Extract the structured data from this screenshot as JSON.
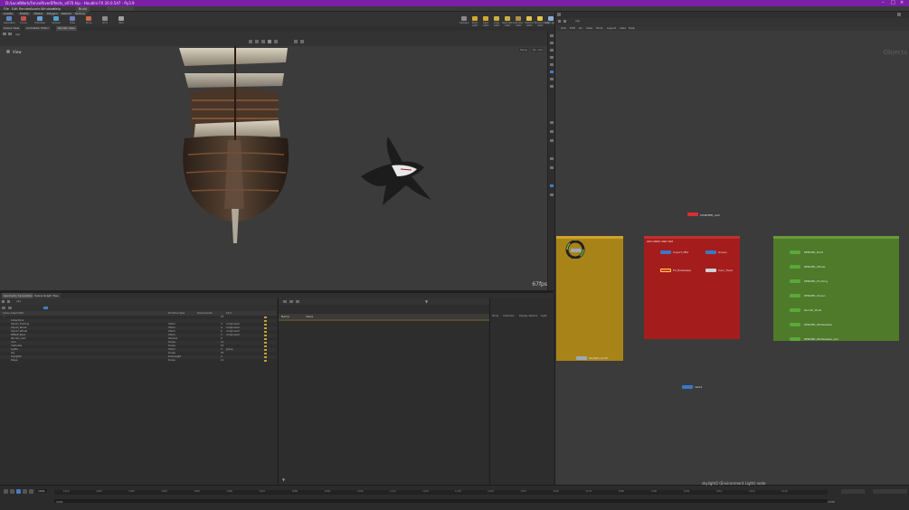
{
  "window": {
    "title": "D:/LocalWork/FenceRiverEffects_v070.hip - Houdini FX 20.0.547 - Py3.9"
  },
  "menu": [
    "File",
    "Edit",
    "Render",
    "Assets",
    "Windows",
    "Help"
  ],
  "workspace": "Build",
  "shelf": {
    "tabs": [
      "Create",
      "Modify",
      "Model",
      "Polygon",
      "Deform",
      "Texture"
    ],
    "tools": [
      "Geometry",
      "Curve",
      "Primitive",
      "Sphere",
      "Tube",
      "Torus",
      "Grid",
      "Null",
      "Circle",
      "Platonic",
      "Box",
      "Line",
      "Spray Paint",
      "Font",
      "L-System",
      "Metaball"
    ]
  },
  "shelf_right": {
    "tools": [
      "Camera",
      "Point Light",
      "Spot Light",
      "Area Light",
      "Geometry Light",
      "Volume Light",
      "Distant Light",
      "Environment Light",
      "Sky Light",
      "GI Light"
    ]
  },
  "pane_tabs": [
    "Scene View",
    "Animation Editor",
    "Render View",
    "Composite View",
    "Motion FX View",
    "Geometry Spreadsheet"
  ],
  "viewport": {
    "label": "View",
    "fps": "67fps",
    "persp_button": "Persp",
    "camera_button": "No cam"
  },
  "bottom_tabs": [
    "Geometry Spreadsheet",
    "Scene Graph Tree"
  ],
  "scene_tree": {
    "columns": [
      "Scene Graph Path",
      "Primitive Type",
      "Descendants",
      "Kind"
    ],
    "rows": [
      {
        "name": "/",
        "type": "",
        "desc": "25",
        "kind": ""
      },
      {
        "name": "Collections",
        "type": "",
        "desc": "",
        "kind": ""
      },
      {
        "name": "Import_Hunting",
        "type": "Xform",
        "desc": "4",
        "kind": "component"
      },
      {
        "name": "Import_Shark",
        "type": "Xform",
        "desc": "4",
        "kind": "component"
      },
      {
        "name": "Import_Whale",
        "type": "Xform",
        "desc": "6",
        "kind": "component"
      },
      {
        "name": "FENCE_Boat",
        "type": "Xform",
        "desc": "3",
        "kind": "component"
      },
      {
        "name": "Render_Cam",
        "type": "Camera",
        "desc": "0",
        "kind": ""
      },
      {
        "name": "cam",
        "type": "Scope",
        "desc": "11",
        "kind": ""
      },
      {
        "name": "materials",
        "type": "Scope",
        "desc": "10",
        "kind": ""
      },
      {
        "name": "Lights",
        "type": "Xform",
        "desc": "3",
        "kind": "group"
      },
      {
        "name": "sky",
        "type": "Scope",
        "desc": "25",
        "kind": ""
      },
      {
        "name": "skylight2",
        "type": "DomeLight",
        "desc": "0",
        "kind": ""
      },
      {
        "name": "Stage",
        "type": "Scope",
        "desc": "11",
        "kind": ""
      }
    ]
  },
  "properties": {
    "columns": [
      "Name",
      "Value"
    ]
  },
  "attr_tabs": [
    "Show",
    "Collection",
    "Display Options",
    "Light"
  ],
  "timeline": {
    "frame": "1001",
    "start": "1001",
    "end": "1240",
    "ticks": [
      "1010",
      "1020",
      "1030",
      "1040",
      "1050",
      "1060",
      "1070",
      "1080",
      "1090",
      "1100",
      "1110",
      "1120",
      "1130",
      "1140",
      "1150",
      "1160",
      "1170",
      "1180",
      "1190",
      "1200",
      "1210",
      "1220",
      "1230"
    ]
  },
  "network": {
    "path": "obj",
    "menu": [
      "Add",
      "Edit",
      "Go",
      "View",
      "Tools",
      "Layout",
      "Labs",
      "Help"
    ],
    "context_label": "Objects",
    "status": "skylight2 (Environment Light) node",
    "boxes": [
      {
        "title": "",
        "color": "#b8901a",
        "nodes": [
          {
            "label": "",
            "color": "#9aa8b8"
          },
          {
            "label": "skylight_rect2",
            "color": "#9aa8b8"
          }
        ]
      },
      {
        "title": "GEO PREP AND SIM",
        "color": "#a51c1c",
        "nodes": [
          {
            "label": "Import_FBX",
            "color": "#3a78c8"
          },
          {
            "label": "Ocean",
            "color": "#3a78c8"
          },
          {
            "label": "FX_Boatwake",
            "color": "#d83030"
          },
          {
            "label": "Cam_Track",
            "color": "#d0d0d0"
          }
        ]
      },
      {
        "title": "",
        "color": "#4e7a2a",
        "nodes": [
          {
            "label": "RENDER_Boat",
            "color": "#5aa83a"
          },
          {
            "label": "RENDER_Whale",
            "color": "#5aa83a"
          },
          {
            "label": "RENDER_Hunting",
            "color": "#5aa83a"
          },
          {
            "label": "RENDER_Ocean",
            "color": "#5aa83a"
          },
          {
            "label": "Render_Boat",
            "color": "#5aa83a"
          },
          {
            "label": "RENDER_Whitewater",
            "color": "#5aa83a"
          },
          {
            "label": "RENDER_Whitewater_sim",
            "color": "#5aa83a"
          }
        ]
      }
    ],
    "loose_nodes": [
      {
        "label": "CHARTER_cam",
        "color": "#d83030"
      },
      {
        "label": "cam1",
        "color": "#3a78c8"
      }
    ]
  }
}
